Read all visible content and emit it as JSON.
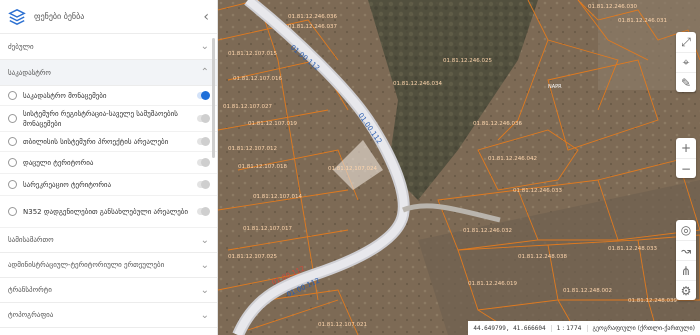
{
  "sidebar": {
    "title": "ფენები ბენბა",
    "sections": [
      {
        "label": "ძებული"
      },
      {
        "label": "საკადასტრო"
      }
    ],
    "items": [
      {
        "label": "საკადასტრო მონაცემები",
        "active": true
      },
      {
        "label": "სისტემური რეგისტრაცია-საველე სამუშაოების მონაცემები",
        "active": false
      },
      {
        "label": "თბილისის სისტემური პროექტის არეალები",
        "active": false
      },
      {
        "label": "დაცული ტერიტორია",
        "active": false
      },
      {
        "label": "სარეკრეაციო ტერიტორია",
        "active": false
      },
      {
        "label": "N352 დადგენილებით განსახლებული არეალები",
        "active": false
      }
    ],
    "bottom_sections": [
      {
        "label": "სამისამართო"
      },
      {
        "label": "ადმინისტრაციულ-ტერიტორიული ერთეულები"
      },
      {
        "label": "ტრანსპორტი"
      },
      {
        "label": "ტოპოგრაფია"
      }
    ]
  },
  "map": {
    "road_labels": [
      "01.00.112",
      "01.00.112",
      "01.00.112",
      "01.00.112"
    ],
    "parcel_labels": [
      "01.81.12.246.036",
      "01.81.12.246.030",
      "01.81.12.246.037",
      "01.81.12.246.031",
      "01.81.12.107.015",
      "01.81.12.107.016",
      "01.81.12.107.027",
      "01.81.12.107.019",
      "01.81.12.246.025",
      "01.81.12.246.034",
      "01.81.12.107.012",
      "01.81.12.246.036",
      "01.81.12.246.042",
      "01.81.12.107.018",
      "01.81.12.107.024",
      "01.81.12.107.014",
      "01.81.12.246.033",
      "01.81.12.246.032",
      "01.81.12.107.017",
      "01.81.12.248.038",
      "01.81.12.107.025",
      "01.81.12.246.019",
      "01.81.12.107.021",
      "01.81.12.248.002",
      "01.81.12.248.039",
      "01.81.12.248.033"
    ],
    "pin_label": "NAPR"
  },
  "status": {
    "coords": "44.649799, 41.666604",
    "scale": "1 : 1774",
    "basemap": "გეოგრაფიული (ქრთლი-ქართული)"
  },
  "colors": {
    "parcel_outline": "#e07a1f",
    "road": "#d7d7dc",
    "road_label": "#2a5db0",
    "toggle_on": "#1e6fd9"
  }
}
